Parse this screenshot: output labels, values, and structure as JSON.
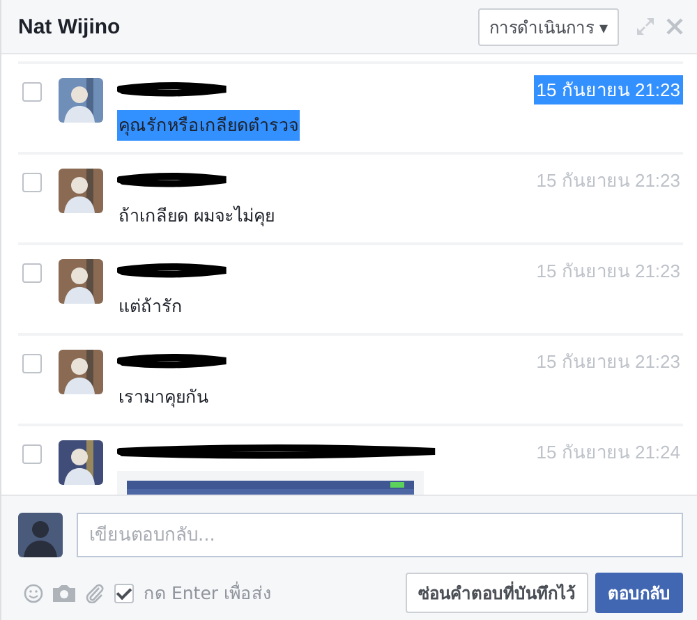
{
  "window": {
    "title": "Nat Wijino",
    "actions_button": "การดำเนินการ ▾"
  },
  "messages": [
    {
      "text": "คุณรักหรือเกลียดตำรวจ",
      "time": "15 กันยายน 21:23",
      "highlighted": true,
      "checked": false
    },
    {
      "text": "ถ้าเกลียด ผมจะไม่คุย",
      "time": "15 กันยายน 21:23",
      "highlighted": false,
      "checked": false
    },
    {
      "text": "แต่ถ้ารัก",
      "time": "15 กันยายน 21:23",
      "highlighted": false,
      "checked": false
    },
    {
      "text": "เรามาคุยกัน",
      "time": "15 กันยายน 21:23",
      "highlighted": false,
      "checked": false
    },
    {
      "time": "15 กันยายน 21:24",
      "highlighted": false,
      "checked": false
    }
  ],
  "composer": {
    "placeholder": "เขียนตอบกลับ...",
    "enter_to_send": {
      "label": "กด Enter เพื่อส่ง",
      "checked": true
    },
    "buttons": [
      {
        "label": "ซ่อนคำตอบที่บันทึกไว้",
        "kind": "secondary"
      },
      {
        "label": "ตอบกลับ",
        "kind": "primary"
      }
    ]
  }
}
